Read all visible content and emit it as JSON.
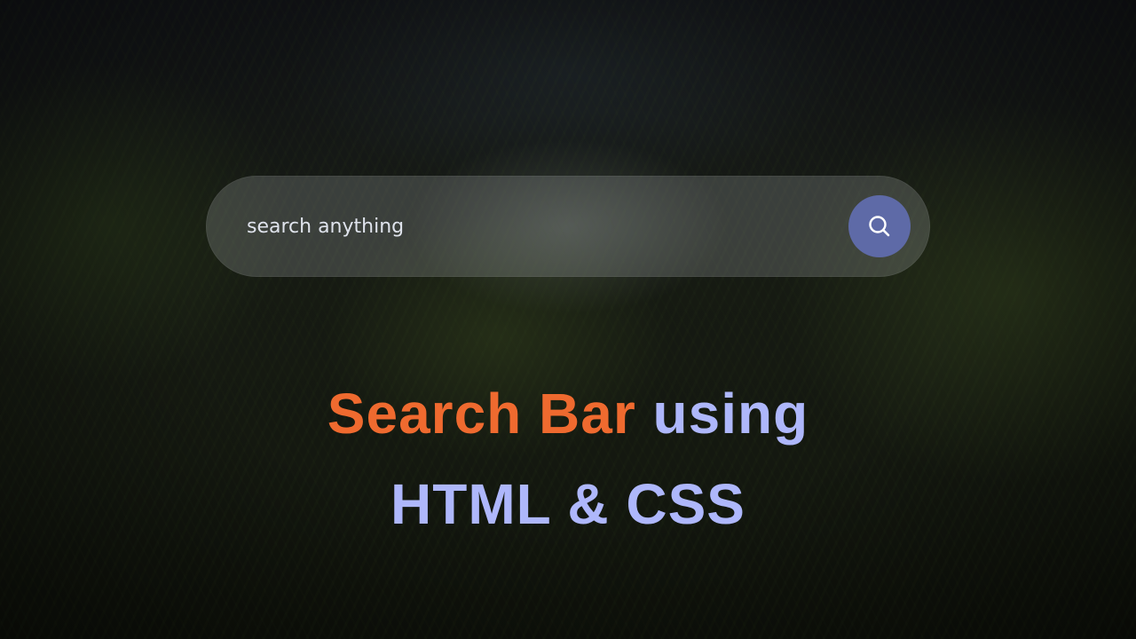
{
  "search": {
    "placeholder": "search anything",
    "button_icon": "search-icon",
    "button_color": "#5e6aa7"
  },
  "headline": {
    "line1_highlight": "Search Bar",
    "line1_rest": "using",
    "line2": "HTML & CSS",
    "highlight_color": "#ef6a2f",
    "text_color": "#aeb7fb"
  }
}
